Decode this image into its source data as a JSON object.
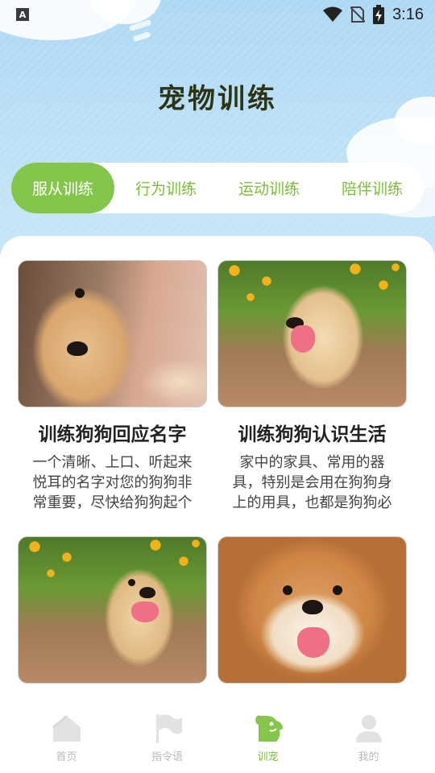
{
  "status_bar": {
    "app_indicator": "A",
    "time": "3:16",
    "icons": [
      "wifi-icon",
      "no-sim-icon",
      "battery-charging-icon"
    ]
  },
  "page": {
    "title": "宠物训练"
  },
  "tabs": [
    {
      "label": "服从训练",
      "active": true
    },
    {
      "label": "行为训练",
      "active": false
    },
    {
      "label": "运动训练",
      "active": false
    },
    {
      "label": "陪伴训练",
      "active": false
    }
  ],
  "cards": [
    {
      "title": "训练狗狗回应名字",
      "desc": "一个清晰、上口、听起来悦耳的名字对您的狗狗非常重要，尽快给狗狗起个",
      "image": "golden-puppy-by-plane-window"
    },
    {
      "title": "训练狗狗认识生活",
      "desc": "家中的家具、常用的器具，特别是会用在狗狗身上的用具，也都是狗狗必",
      "image": "golden-puppy-on-deck-with-flowers"
    },
    {
      "title": "",
      "desc": "",
      "image": "golden-puppy-smiling-outdoors"
    },
    {
      "title": "",
      "desc": "",
      "image": "shiba-inu-smiling"
    }
  ],
  "bottom_nav": [
    {
      "label": "首页",
      "icon": "home-icon",
      "active": false
    },
    {
      "label": "指令语",
      "icon": "flag-icon",
      "active": false
    },
    {
      "label": "训宠",
      "icon": "dog-icon",
      "active": true
    },
    {
      "label": "我的",
      "icon": "user-icon",
      "active": false
    }
  ],
  "colors": {
    "accent": "#84c64b",
    "tab_text": "#7dbb3f",
    "title": "#2b3415",
    "sky": "#b8def6",
    "nav_inactive": "#b8b8b8"
  }
}
